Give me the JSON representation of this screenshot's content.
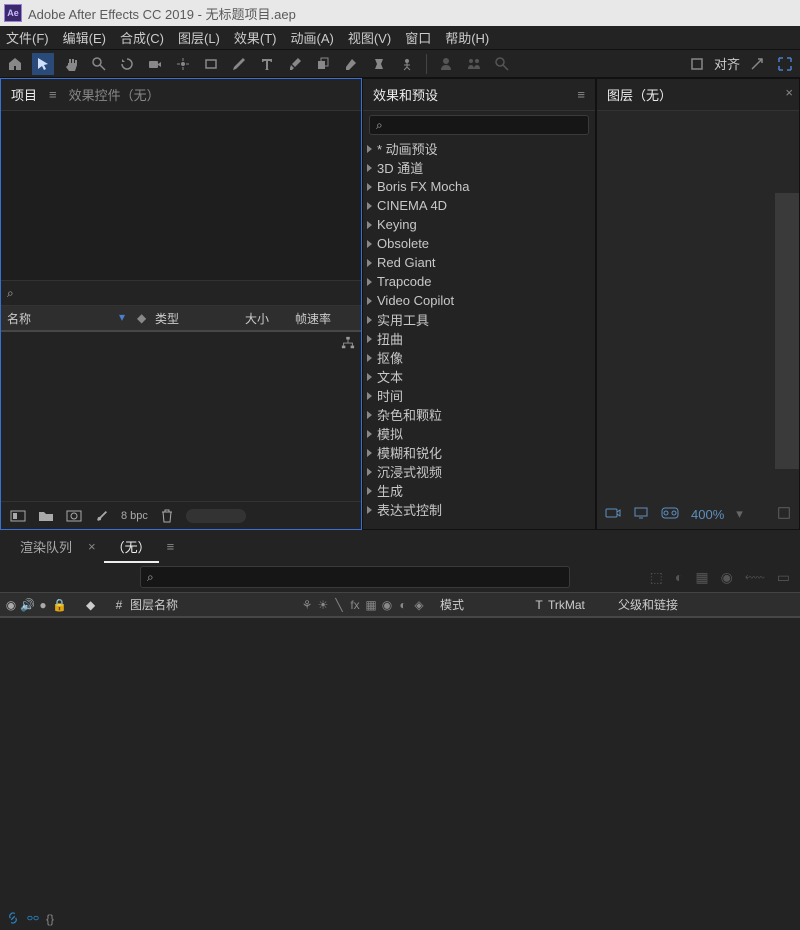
{
  "titlebar": {
    "app": "Adobe After Effects CC 2019",
    "sep": " - ",
    "doc": "无标题项目.aep"
  },
  "menu": [
    "文件(F)",
    "编辑(E)",
    "合成(C)",
    "图层(L)",
    "效果(T)",
    "动画(A)",
    "视图(V)",
    "窗口",
    "帮助(H)"
  ],
  "toolbar_label": "对齐",
  "project": {
    "tab_project": "项目",
    "tab_effect_controls": "效果控件（无）",
    "menu_glyph": "≡",
    "search_glyph": "⌕",
    "cols": {
      "name": "名称",
      "type": "类型",
      "size": "大小",
      "fps": "帧速率"
    },
    "footer_bpc": "8 bpc"
  },
  "effects": {
    "title": "效果和预设",
    "menu_glyph": "≡",
    "search_glyph": "⌕",
    "items": [
      "* 动画预设",
      "3D 通道",
      "Boris FX Mocha",
      "CINEMA 4D",
      "Keying",
      "Obsolete",
      "Red Giant",
      "Trapcode",
      "Video Copilot",
      "实用工具",
      "扭曲",
      "抠像",
      "文本",
      "时间",
      "杂色和颗粒",
      "模拟",
      "模糊和锐化",
      "沉浸式视频",
      "生成",
      "表达式控制"
    ]
  },
  "layer": {
    "title": "图层（无）",
    "zoom": "400%"
  },
  "timeline": {
    "tab_render": "渲染队列",
    "tab_none": "（无）",
    "menu_glyph": "≡",
    "close_glyph": "×",
    "search_glyph": "⌕",
    "headers": {
      "hash": "#",
      "layer_name": "图层名称",
      "mode": "模式",
      "t": "T",
      "trkmat": "TrkMat",
      "parent": "父级和链接"
    }
  }
}
